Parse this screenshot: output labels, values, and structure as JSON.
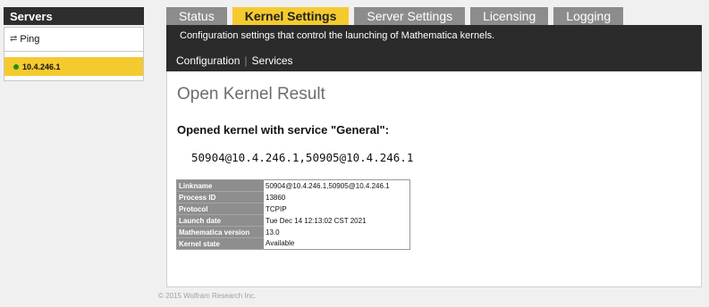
{
  "sidebar": {
    "header": "Servers",
    "ping_label": "Ping",
    "server": {
      "address": "10.4.246.1",
      "status_color": "#1b8f1b"
    }
  },
  "tabs": [
    {
      "label": "Status",
      "active": false
    },
    {
      "label": "Kernel Settings",
      "active": true
    },
    {
      "label": "Server Settings",
      "active": false
    },
    {
      "label": "Licensing",
      "active": false
    },
    {
      "label": "Logging",
      "active": false
    }
  ],
  "header": {
    "description": "Configuration settings that control the launching of Mathematica kernels.",
    "subnav": {
      "configuration": "Configuration",
      "separator": "|",
      "services": "Services"
    }
  },
  "content": {
    "title": "Open Kernel Result",
    "heading": "Opened kernel with service \"General\":",
    "linkname_display": "50904@10.4.246.1,50905@10.4.246.1",
    "table": [
      {
        "key": "Linkname",
        "value": "50904@10.4.246.1,50905@10.4.246.1"
      },
      {
        "key": "Process ID",
        "value": "13860"
      },
      {
        "key": "Protocol",
        "value": "TCPIP"
      },
      {
        "key": "Launch date",
        "value": "Tue Dec 14 12:13:02 CST 2021"
      },
      {
        "key": "Mathematica version",
        "value": "13.0"
      },
      {
        "key": "Kernel state",
        "value": "Available"
      }
    ]
  },
  "footer": "© 2015 Wolfram Research Inc.",
  "colors": {
    "accent": "#f5ca2f",
    "dark": "#2b2b2b",
    "tab": "#8c8c8c"
  }
}
